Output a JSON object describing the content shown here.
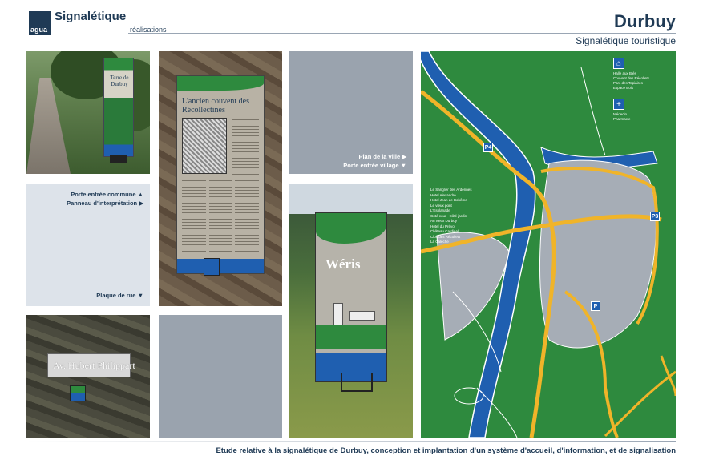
{
  "header": {
    "logo_text": "agua",
    "brand": "Signalétique",
    "brand_sub": "réalisations",
    "title": "Durbuy",
    "subtitle": "Signalétique touristique"
  },
  "tiles": {
    "totem_photo": {
      "sign_text": "Terre de Durbuy"
    },
    "panel_photo": {
      "panel_title": "L'ancien couvent des Récollectines"
    },
    "grey_top": {
      "labels": [
        "Plan de la ville ▶",
        "Porte entrée village ▼"
      ]
    },
    "light_left": {
      "labels": [
        "Porte entrée commune ▲",
        "Panneau d'interprétation ▶"
      ],
      "bottom_label": "Plaque de rue ▼"
    },
    "weris_photo": {
      "sign_title": "Wéris"
    },
    "street_photo": {
      "sign_text": "Av. Hubert Philippart"
    }
  },
  "map": {
    "legend": [
      "Le Sanglier des Ardennes",
      "Hôtel Alexandre",
      "Hôtel Jean de Bohême",
      "Le vieux pont",
      "L'Esplanade",
      "Côté cour - Côté jardin",
      "Au vieux Durbuy",
      "Hôtel du Prévot",
      "Château Cardinal",
      "Clos des Récollets",
      "La Calèche"
    ],
    "key_top": [
      "Halle aux Blés",
      "Couvent des Récollets",
      "Parc des Topiaires",
      "Espace Bois"
    ],
    "key_bottom": [
      "Médecin",
      "Pharmacie"
    ],
    "parkings": [
      "P4",
      "P3",
      "P"
    ]
  },
  "footer": {
    "text": "Etude relative à la signalétique de Durbuy, conception et implantation d'un système d'accueil, d'information, et de signalisation"
  },
  "colors": {
    "navy": "#1f3a55",
    "green": "#2e8a3e",
    "blue": "#1f5fb0",
    "road": "#f0b429",
    "grey_tile": "#9aa3ae"
  }
}
